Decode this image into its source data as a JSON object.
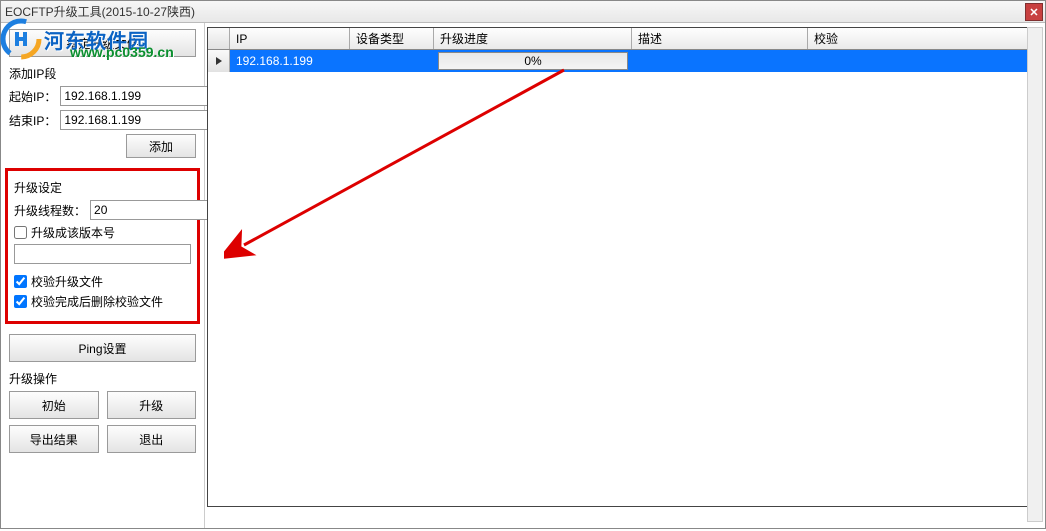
{
  "title": "EOCFTP升级工具(2015-10-27陕西)",
  "watermark": {
    "brand": "河东软件园",
    "url": "www.pc0359.cn"
  },
  "sidebar": {
    "select_file_btn": "指定升级文件",
    "ip_section": {
      "title": "添加IP段",
      "start_label": "起始IP：",
      "start_value": "192.168.1.199",
      "end_label": "结束IP：",
      "end_value": "192.168.1.199",
      "add_btn": "添加"
    },
    "settings": {
      "title": "升级设定",
      "threads_label": "升级线程数：",
      "threads_value": "20",
      "version_check": "升级成该版本号",
      "version_checked": false,
      "version_value": "",
      "verify_check": "校验升级文件",
      "verify_checked": true,
      "delete_check": "校验完成后删除校验文件",
      "delete_checked": true
    },
    "ping_btn": "Ping设置",
    "ops": {
      "title": "升级操作",
      "init_btn": "初始",
      "upgrade_btn": "升级",
      "export_btn": "导出结果",
      "exit_btn": "退出"
    }
  },
  "grid": {
    "columns": {
      "ip": "IP",
      "type": "设备类型",
      "progress": "升级进度",
      "desc": "描述",
      "check": "校验"
    },
    "rows": [
      {
        "ip": "192.168.1.199",
        "type": "",
        "progress_text": "0%",
        "desc": "",
        "check": ""
      }
    ]
  }
}
